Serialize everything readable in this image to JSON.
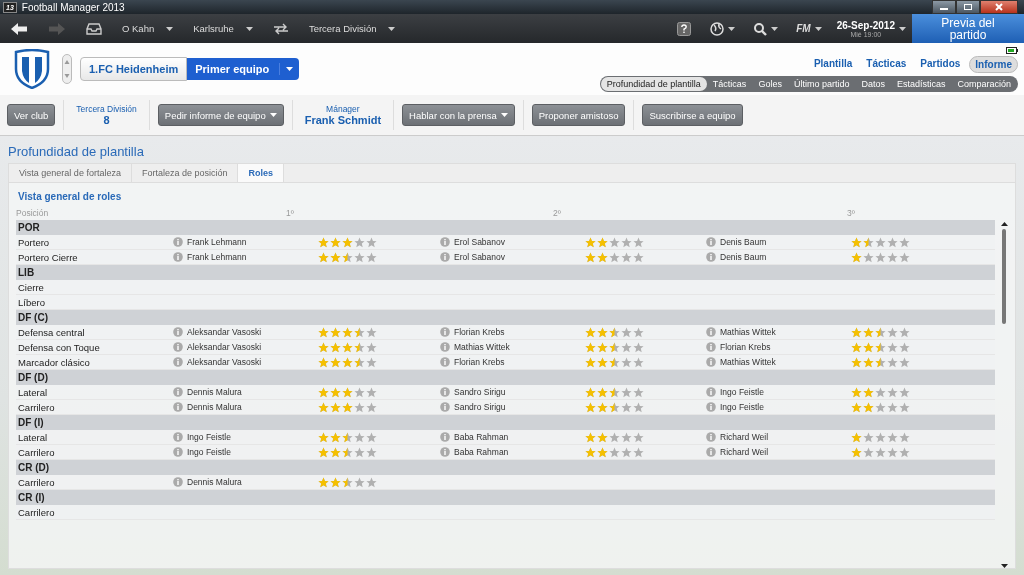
{
  "window": {
    "icon_label": "13",
    "title": "Football Manager 2013"
  },
  "toolbar": {
    "nav": [
      {
        "label": "O Kahn"
      },
      {
        "label": "Karlsruhe"
      },
      {
        "label": "Tercera División"
      }
    ],
    "logo": "FM",
    "date": "26-Sep-2012",
    "time": "Mié 19:00",
    "match_button": "Previa del partido"
  },
  "header": {
    "club": "1.FC Heidenheim",
    "squad": "Primer equipo",
    "main_tabs": [
      {
        "label": "Plantilla",
        "selected": false
      },
      {
        "label": "Tácticas",
        "selected": false
      },
      {
        "label": "Partidos",
        "selected": false
      },
      {
        "label": "Informe",
        "selected": true
      }
    ],
    "sub_tabs": [
      {
        "label": "Profundidad de plantilla",
        "selected": true
      },
      {
        "label": "Tácticas",
        "selected": false
      },
      {
        "label": "Goles",
        "selected": false
      },
      {
        "label": "Último partido",
        "selected": false
      },
      {
        "label": "Datos",
        "selected": false
      },
      {
        "label": "Estadísticas",
        "selected": false
      },
      {
        "label": "Comparación",
        "selected": false
      }
    ]
  },
  "action_bar": [
    {
      "kind": "button",
      "label": "Ver club",
      "dropdown": false
    },
    {
      "kind": "info",
      "label": "Tercera División",
      "value": "8"
    },
    {
      "kind": "button",
      "label": "Pedir informe de equipo",
      "dropdown": true
    },
    {
      "kind": "info",
      "label": "Mánager",
      "value": "Frank Schmidt"
    },
    {
      "kind": "button",
      "label": "Hablar con la prensa",
      "dropdown": true
    },
    {
      "kind": "button",
      "label": "Proponer amistoso",
      "dropdown": false
    },
    {
      "kind": "button",
      "label": "Suscribirse a equipo",
      "dropdown": false
    }
  ],
  "panel": {
    "title": "Profundidad de plantilla",
    "tabs": [
      {
        "label": "Vista general de fortaleza",
        "selected": false
      },
      {
        "label": "Fortaleza de posición",
        "selected": false
      },
      {
        "label": "Roles",
        "selected": true
      }
    ],
    "section_title": "Vista general de roles",
    "columns": [
      "Posición",
      "1º",
      "2º",
      "3º"
    ],
    "rows": [
      {
        "kind": "group",
        "label": "POR"
      },
      {
        "kind": "role",
        "label": "Portero",
        "players": [
          {
            "name": "Frank Lehmann",
            "stars": 3
          },
          {
            "name": "Erol Sabanov",
            "stars": 2
          },
          {
            "name": "Denis Baum",
            "stars": 1.5
          }
        ]
      },
      {
        "kind": "role",
        "label": "Portero Cierre",
        "players": [
          {
            "name": "Frank Lehmann",
            "stars": 2.5
          },
          {
            "name": "Erol Sabanov",
            "stars": 2
          },
          {
            "name": "Denis Baum",
            "stars": 1
          }
        ]
      },
      {
        "kind": "group",
        "label": "LIB"
      },
      {
        "kind": "role",
        "label": "Cierre",
        "players": []
      },
      {
        "kind": "role",
        "label": "Líbero",
        "players": []
      },
      {
        "kind": "group",
        "label": "DF (C)"
      },
      {
        "kind": "role",
        "label": "Defensa central",
        "players": [
          {
            "name": "Aleksandar Vasoski",
            "stars": 3.5
          },
          {
            "name": "Florian Krebs",
            "stars": 2.5
          },
          {
            "name": "Mathias Wittek",
            "stars": 2.5
          }
        ]
      },
      {
        "kind": "role",
        "label": "Defensa con Toque",
        "players": [
          {
            "name": "Aleksandar Vasoski",
            "stars": 3.5
          },
          {
            "name": "Mathias Wittek",
            "stars": 2.5
          },
          {
            "name": "Florian Krebs",
            "stars": 2.5
          }
        ]
      },
      {
        "kind": "role",
        "label": "Marcador clásico",
        "players": [
          {
            "name": "Aleksandar Vasoski",
            "stars": 3.5
          },
          {
            "name": "Florian Krebs",
            "stars": 2.5
          },
          {
            "name": "Mathias Wittek",
            "stars": 2.5
          }
        ]
      },
      {
        "kind": "group",
        "label": "DF (D)"
      },
      {
        "kind": "role",
        "label": "Lateral",
        "players": [
          {
            "name": "Dennis Malura",
            "stars": 3
          },
          {
            "name": "Sandro Sirigu",
            "stars": 2.5
          },
          {
            "name": "Ingo Feistle",
            "stars": 2
          }
        ]
      },
      {
        "kind": "role",
        "label": "Carrilero",
        "players": [
          {
            "name": "Dennis Malura",
            "stars": 3
          },
          {
            "name": "Sandro Sirigu",
            "stars": 2.5
          },
          {
            "name": "Ingo Feistle",
            "stars": 2
          }
        ]
      },
      {
        "kind": "group",
        "label": "DF (I)"
      },
      {
        "kind": "role",
        "label": "Lateral",
        "players": [
          {
            "name": "Ingo Feistle",
            "stars": 2.5
          },
          {
            "name": "Baba Rahman",
            "stars": 2
          },
          {
            "name": "Richard Weil",
            "stars": 1
          }
        ]
      },
      {
        "kind": "role",
        "label": "Carrilero",
        "players": [
          {
            "name": "Ingo Feistle",
            "stars": 2.5
          },
          {
            "name": "Baba Rahman",
            "stars": 2
          },
          {
            "name": "Richard Weil",
            "stars": 1
          }
        ]
      },
      {
        "kind": "group",
        "label": "CR (D)"
      },
      {
        "kind": "role",
        "label": "Carrilero",
        "players": [
          {
            "name": "Dennis Malura",
            "stars": 2.5
          }
        ]
      },
      {
        "kind": "group",
        "label": "CR (I)"
      },
      {
        "kind": "role",
        "label": "Carrilero",
        "players": []
      }
    ]
  }
}
